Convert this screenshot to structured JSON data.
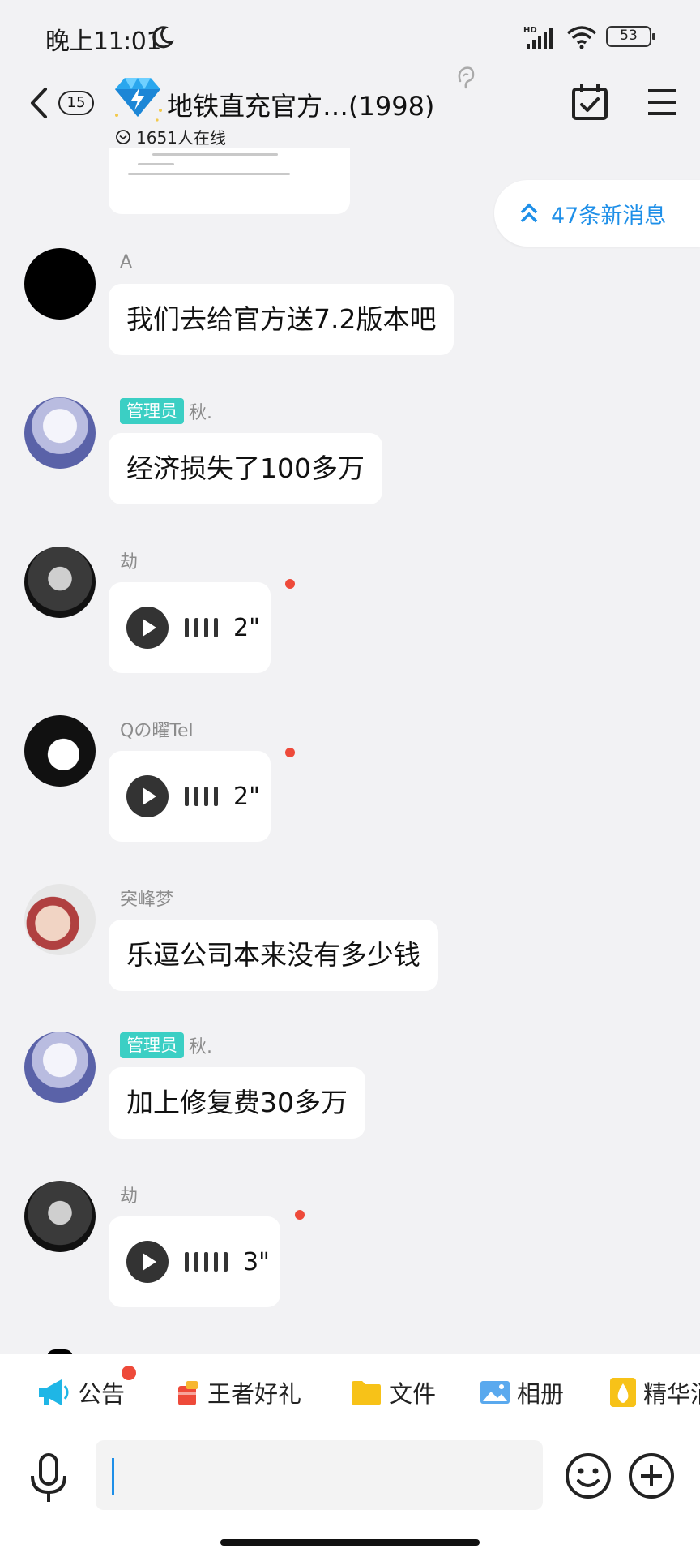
{
  "status_bar": {
    "time": "晚上11:01",
    "battery": "53"
  },
  "header": {
    "unread_count": "15",
    "title": "地铁直充官方…(1998)",
    "online": "1651人在线"
  },
  "new_messages_pill": "47条新消息",
  "messages": [
    {
      "sender": "A",
      "admin": false,
      "type": "text",
      "text": "我们去给官方送7.2版本吧"
    },
    {
      "sender": "秋.",
      "admin": true,
      "type": "text",
      "text": "经济损失了100多万"
    },
    {
      "sender": "劫",
      "admin": false,
      "type": "voice",
      "duration": "2\"",
      "unread": true
    },
    {
      "sender": "Qの曜Tel",
      "admin": false,
      "type": "voice",
      "duration": "2\"",
      "unread": true
    },
    {
      "sender": "突峰梦",
      "admin": false,
      "type": "text",
      "text": "乐逗公司本来没有多少钱"
    },
    {
      "sender": "秋.",
      "admin": true,
      "type": "text",
      "text": "加上修复费30多万"
    },
    {
      "sender": "劫",
      "admin": false,
      "type": "voice",
      "duration": "3\"",
      "unread": true
    }
  ],
  "admin_badge": "管理员",
  "toolbar": {
    "items": [
      "公告",
      "王者好礼",
      "文件",
      "相册",
      "精华消"
    ]
  },
  "input": {
    "value": ""
  },
  "colors": {
    "accent": "#1e8fe8",
    "admin_badge": "#3bcfc4",
    "unread_dot": "#ee4a3a"
  }
}
